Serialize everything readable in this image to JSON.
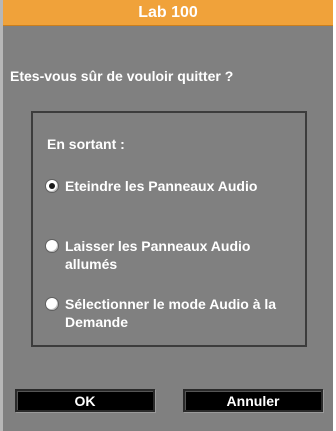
{
  "dialog": {
    "title": "Lab 100",
    "question": "Etes-vous sûr de vouloir quitter ?",
    "group": {
      "label": "En sortant :",
      "options": [
        {
          "label": "Eteindre les Panneaux Audio",
          "selected": true
        },
        {
          "label": "Laisser les Panneaux Audio allumés",
          "selected": false
        },
        {
          "label": "Sélectionner le mode Audio à la Demande",
          "selected": false
        }
      ]
    },
    "buttons": {
      "ok": "OK",
      "cancel": "Annuler"
    }
  },
  "colors": {
    "title_bar": "#f0a23a",
    "background": "#808080",
    "text": "#ffffff",
    "button": "#000000"
  }
}
